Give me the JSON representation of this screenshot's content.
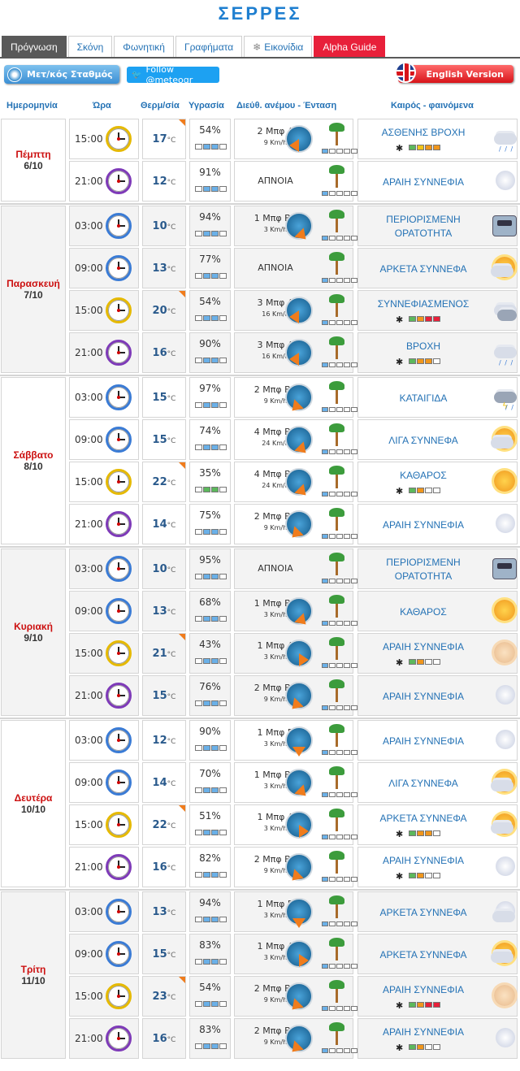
{
  "title": "ΣΕΡΡΕΣ",
  "tabs": [
    {
      "label": "Πρόγνωση",
      "active": true
    },
    {
      "label": "Σκόνη"
    },
    {
      "label": "Φωνητική"
    },
    {
      "label": "Γραφήματα"
    },
    {
      "label": "Εικονίδια"
    },
    {
      "label": "Alpha Guide",
      "highlight": true
    }
  ],
  "buttons": {
    "stations": "Μετ/κός Σταθμός",
    "follow": "Follow @meteogr",
    "english": "English Version"
  },
  "headers": {
    "date": "Ημερομηνία",
    "time": "Ώρα",
    "temp": "Θερμ/σία",
    "humidity": "Υγρασία",
    "wind": "Διεύθ. ανέμου - Ένταση",
    "weather": "Καιρός - φαινόμενα"
  },
  "temp_unit": "°C",
  "days": [
    {
      "name": "Πέμπτη",
      "date": "6/10",
      "rows": [
        {
          "time": "15:00",
          "clock": "yellow",
          "temp": "17",
          "hot": true,
          "hum": "54%",
          "humbars": "oo",
          "wind": "2 Μπφ Α",
          "speed": "9 Km/h",
          "dir": 180,
          "wbars": 1,
          "wx": "ΑΣΘΕΝΗΣ ΒΡΟΧΗ",
          "mosq": "gyoo",
          "icon": "rain"
        },
        {
          "time": "21:00",
          "clock": "purple",
          "temp": "12",
          "hum": "91%",
          "humbars": "oo",
          "wind": "ΑΠΝΟΙΑ",
          "speed": "",
          "dir": null,
          "wbars": 1,
          "wx": "ΑΡΑΙΗ ΣΥΝΝΕΦΙΑ",
          "icon": "moon"
        }
      ]
    },
    {
      "name": "Παρασκευή",
      "date": "7/10",
      "rows": [
        {
          "time": "03:00",
          "clock": "blue",
          "temp": "10",
          "hum": "94%",
          "humbars": "oo",
          "wind": "1 Μπφ ΒΔ",
          "speed": "3 Km/h",
          "dir": 45,
          "wbars": 1,
          "wx": "ΠΕΡΙΟΡΙΣΜΕΝΗ ΟΡΑΤΟΤΗΤΑ",
          "icon": "fog"
        },
        {
          "time": "09:00",
          "clock": "blue",
          "temp": "13",
          "hum": "77%",
          "humbars": "oo",
          "wind": "ΑΠΝΟΙΑ",
          "speed": "",
          "dir": null,
          "wbars": 1,
          "wx": "ΑΡΚΕΤΑ ΣΥΝΝΕΦΑ",
          "icon": "suncloud"
        },
        {
          "time": "15:00",
          "clock": "yellow",
          "temp": "20",
          "hot": true,
          "hum": "54%",
          "humbars": "oo",
          "wind": "3 Μπφ Α",
          "speed": "16 Km/h",
          "dir": 180,
          "wbars": 1,
          "wx": "ΣΥΝΝΕΦΙΑΣΜΕΝΟΣ",
          "mosq": "gorr",
          "icon": "clouds"
        },
        {
          "time": "21:00",
          "clock": "purple",
          "temp": "16",
          "hum": "90%",
          "humbars": "oo",
          "wind": "3 Μπφ Α",
          "speed": "16 Km/h",
          "dir": 180,
          "wbars": 1,
          "wx": "ΒΡΟΧΗ",
          "mosq": "goo",
          "icon": "rain"
        }
      ]
    },
    {
      "name": "Σάββατο",
      "date": "8/10",
      "rows": [
        {
          "time": "03:00",
          "clock": "blue",
          "temp": "15",
          "hum": "97%",
          "humbars": "oo",
          "wind": "2 Μπφ ΒΑ",
          "speed": "9 Km/h",
          "dir": 135,
          "wbars": 1,
          "wx": "ΚΑΤΑΙΓΙΔΑ",
          "icon": "storm"
        },
        {
          "time": "09:00",
          "clock": "blue",
          "temp": "15",
          "hum": "74%",
          "humbars": "oo",
          "wind": "4 Μπφ ΒΔ",
          "speed": "24 Km/h",
          "dir": 45,
          "wbars": 1,
          "wx": "ΛΙΓΑ ΣΥΝΝΕΦΑ",
          "icon": "suncloud"
        },
        {
          "time": "15:00",
          "clock": "yellow",
          "temp": "22",
          "hot": true,
          "hum": "35%",
          "humbars": "gg",
          "wind": "4 Μπφ ΒΔ",
          "speed": "24 Km/h",
          "dir": 45,
          "wbars": 1,
          "wx": "ΚΑΘΑΡΟΣ",
          "mosq": "go",
          "icon": "sun"
        },
        {
          "time": "21:00",
          "clock": "purple",
          "temp": "14",
          "hum": "75%",
          "humbars": "oo",
          "wind": "2 Μπφ ΒΑ",
          "speed": "9 Km/h",
          "dir": 135,
          "wbars": 1,
          "wx": "ΑΡΑΙΗ ΣΥΝΝΕΦΙΑ",
          "icon": "moon"
        }
      ]
    },
    {
      "name": "Κυριακή",
      "date": "9/10",
      "rows": [
        {
          "time": "03:00",
          "clock": "blue",
          "temp": "10",
          "hum": "95%",
          "humbars": "oo",
          "wind": "ΑΠΝΟΙΑ",
          "speed": "",
          "dir": null,
          "wbars": 1,
          "wx": "ΠΕΡΙΟΡΙΣΜΕΝΗ ΟΡΑΤΟΤΗΤΑ",
          "icon": "fog"
        },
        {
          "time": "09:00",
          "clock": "blue",
          "temp": "13",
          "hum": "68%",
          "humbars": "oo",
          "wind": "1 Μπφ ΒΔ",
          "speed": "3 Km/h",
          "dir": 45,
          "wbars": 1,
          "wx": "ΚΑΘΑΡΟΣ",
          "icon": "sun"
        },
        {
          "time": "15:00",
          "clock": "yellow",
          "temp": "21",
          "hot": true,
          "hum": "43%",
          "humbars": "oo",
          "wind": "1 Μπφ Δ",
          "speed": "3 Km/h",
          "dir": 0,
          "wbars": 1,
          "wx": "ΑΡΑΙΗ ΣΥΝΝΕΦΙΑ",
          "mosq": "go",
          "icon": "palesun"
        },
        {
          "time": "21:00",
          "clock": "purple",
          "temp": "15",
          "hum": "76%",
          "humbars": "oo",
          "wind": "2 Μπφ ΒΑ",
          "speed": "9 Km/h",
          "dir": 135,
          "wbars": 1,
          "wx": "ΑΡΑΙΗ ΣΥΝΝΕΦΙΑ",
          "icon": "moon"
        }
      ]
    },
    {
      "name": "Δευτέρα",
      "date": "10/10",
      "rows": [
        {
          "time": "03:00",
          "clock": "blue",
          "temp": "12",
          "hum": "90%",
          "humbars": "oo",
          "wind": "1 Μπφ Β",
          "speed": "3 Km/h",
          "dir": 90,
          "wbars": 1,
          "wx": "ΑΡΑΙΗ ΣΥΝΝΕΦΙΑ",
          "icon": "moon"
        },
        {
          "time": "09:00",
          "clock": "blue",
          "temp": "14",
          "hum": "70%",
          "humbars": "oo",
          "wind": "1 Μπφ ΒΔ",
          "speed": "3 Km/h",
          "dir": 45,
          "wbars": 1,
          "wx": "ΛΙΓΑ ΣΥΝΝΕΦΑ",
          "icon": "suncloud"
        },
        {
          "time": "15:00",
          "clock": "yellow",
          "temp": "22",
          "hot": true,
          "hum": "51%",
          "humbars": "oo",
          "wind": "1 Μπφ Δ",
          "speed": "3 Km/h",
          "dir": 0,
          "wbars": 1,
          "wx": "ΑΡΚΕΤΑ ΣΥΝΝΕΦΑ",
          "mosq": "goo",
          "icon": "suncloud"
        },
        {
          "time": "21:00",
          "clock": "purple",
          "temp": "16",
          "hum": "82%",
          "humbars": "oo",
          "wind": "2 Μπφ ΒΑ",
          "speed": "9 Km/h",
          "dir": 135,
          "wbars": 1,
          "wx": "ΑΡΑΙΗ ΣΥΝΝΕΦΙΑ",
          "mosq": "go",
          "icon": "moon"
        }
      ]
    },
    {
      "name": "Τρίτη",
      "date": "11/10",
      "rows": [
        {
          "time": "03:00",
          "clock": "blue",
          "temp": "13",
          "hum": "94%",
          "humbars": "oo",
          "wind": "1 Μπφ Β",
          "speed": "3 Km/h",
          "dir": 90,
          "wbars": 1,
          "wx": "ΑΡΚΕΤΑ ΣΥΝΝΕΦΑ",
          "icon": "mooncloud"
        },
        {
          "time": "09:00",
          "clock": "blue",
          "temp": "15",
          "hum": "83%",
          "humbars": "oo",
          "wind": "1 Μπφ Δ",
          "speed": "3 Km/h",
          "dir": 0,
          "wbars": 1,
          "wx": "ΑΡΚΕΤΑ ΣΥΝΝΕΦΑ",
          "icon": "suncloud"
        },
        {
          "time": "15:00",
          "clock": "yellow",
          "temp": "23",
          "hot": true,
          "hum": "54%",
          "humbars": "oo",
          "wind": "2 Μπφ ΒΑ",
          "speed": "9 Km/h",
          "dir": 135,
          "wbars": 1,
          "wx": "ΑΡΑΙΗ ΣΥΝΝΕΦΙΑ",
          "mosq": "gorr",
          "icon": "palesun"
        },
        {
          "time": "21:00",
          "clock": "purple",
          "temp": "16",
          "hum": "83%",
          "humbars": "oo",
          "wind": "2 Μπφ ΒΑ",
          "speed": "9 Km/h",
          "dir": 135,
          "wbars": 1,
          "wx": "ΑΡΑΙΗ ΣΥΝΝΕΦΙΑ",
          "mosq": "go",
          "icon": "moon"
        }
      ]
    }
  ]
}
